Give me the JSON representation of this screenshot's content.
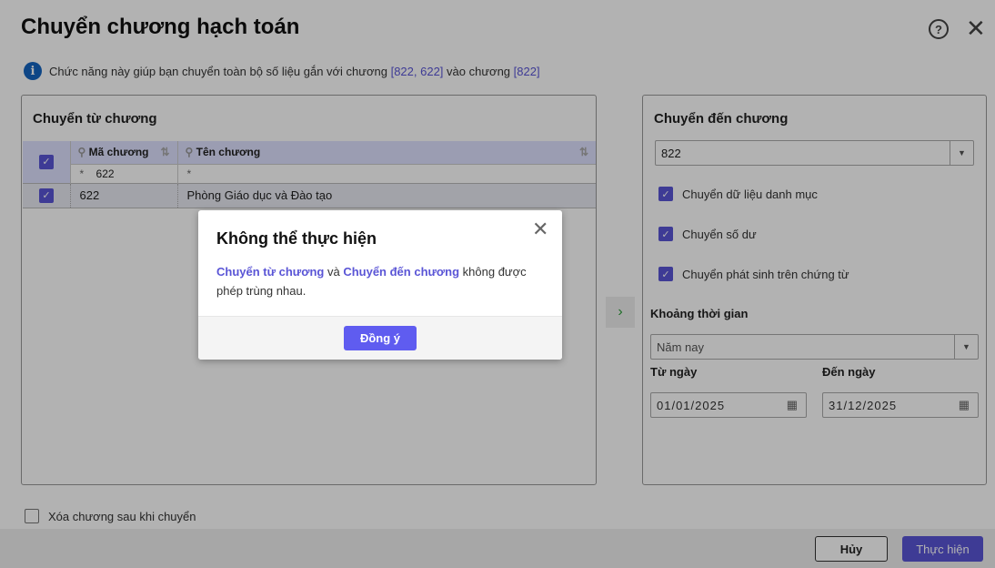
{
  "dialog": {
    "title": "Chuyển chương hạch toán",
    "info_prefix": "Chức năng này giúp bạn chuyển toàn bộ số liệu gắn với chương ",
    "info_from": "[822, 622]",
    "info_mid": " vào chương ",
    "info_to": "[822]"
  },
  "from_panel": {
    "title": "Chuyển từ chương",
    "columns": [
      "Mã chương",
      "Tên chương"
    ],
    "filter_code": "622",
    "filter_symbol": "*",
    "rows": [
      {
        "code": "622",
        "name": "Phòng Giáo dục và Đào tạo",
        "checked": true
      }
    ]
  },
  "to_panel": {
    "title": "Chuyển đến chương",
    "selected": "822",
    "options": [
      {
        "label": "Chuyển dữ liệu danh mục",
        "checked": true
      },
      {
        "label": "Chuyển số dư",
        "checked": true
      },
      {
        "label": "Chuyển phát sinh trên chứng từ",
        "checked": true
      }
    ],
    "period_label": "Khoảng thời gian",
    "period_value": "Năm nay",
    "from_date_label": "Từ ngày",
    "from_date": "01/01/2025",
    "to_date_label": "Đến ngày",
    "to_date": "31/12/2025"
  },
  "delete_after": "Xóa chương sau khi chuyển",
  "footer": {
    "cancel": "Hủy",
    "execute": "Thực hiện"
  },
  "alert": {
    "title": "Không thể thực hiện",
    "from": "Chuyển từ chương",
    "and": " và ",
    "to": "Chuyển đến chương",
    "rest": " không được phép trùng nhau.",
    "ok": "Đồng ý"
  }
}
